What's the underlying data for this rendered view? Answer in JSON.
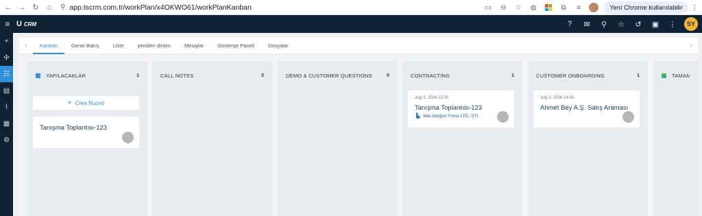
{
  "browser": {
    "url": "app.tscrm.com.tr/workPlan/x4OKWO61/workPlanKanban",
    "profile_pill": "Yeni Chrome kullanılabilir"
  },
  "app": {
    "logo_mark": "U",
    "logo_text": "CRM",
    "user_initials": "SY"
  },
  "tabs": [
    {
      "label": "Kanban"
    },
    {
      "label": "Genel Bakış"
    },
    {
      "label": "Liste"
    },
    {
      "label": "yeniden dinlen"
    },
    {
      "label": "Mesajlar"
    },
    {
      "label": "Gösterge Paneli"
    },
    {
      "label": "Dosyalar"
    }
  ],
  "columns": [
    {
      "title": "YAPILACAKLAR",
      "count": "1",
      "dot_color": "#3b8fd4",
      "new_label": "Crea Nuovo",
      "card": {
        "title": "Tanışma Toplantısı-123"
      }
    },
    {
      "title": "CALL NOTES",
      "count": "0"
    },
    {
      "title": "DEMO & CUSTOMER QUESTIONS",
      "count": "0"
    },
    {
      "title": "CONTRACTING",
      "count": "1",
      "card": {
        "date": "July 3, 2026 15:00",
        "title": "Tanışma Toplantısı-123",
        "company": "Mal Aldığım Firma LTD. ŞTİ."
      }
    },
    {
      "title": "CUSTOMER ONBOARDING",
      "count": "1",
      "card": {
        "date": "July 3, 2026 14:00",
        "title": "Ahmet Bey A.Ş. Satış Araması"
      }
    },
    {
      "title": "TAMAM",
      "dot_color": "#3cb371"
    }
  ],
  "icons": {
    "back": "arrow-left-icon",
    "forward": "arrow-right-icon",
    "reload": "reload-icon",
    "home": "home-icon"
  }
}
